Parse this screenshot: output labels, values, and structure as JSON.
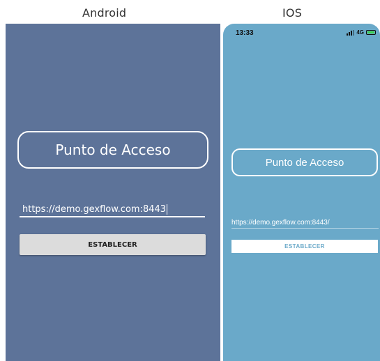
{
  "labels": {
    "android": "Android",
    "ios": "IOS"
  },
  "android": {
    "title": "Punto de Acceso",
    "url_value": "https://demo.gexflow.com:8443",
    "button_label": "ESTABLECER",
    "background": "#5d7399"
  },
  "ios": {
    "time": "13:33",
    "network": "4G",
    "title": "Punto de Acceso",
    "url_value": "https://demo.gexflow.com:8443/",
    "button_label": "ESTABLECER",
    "background": "#6aa9c9"
  }
}
